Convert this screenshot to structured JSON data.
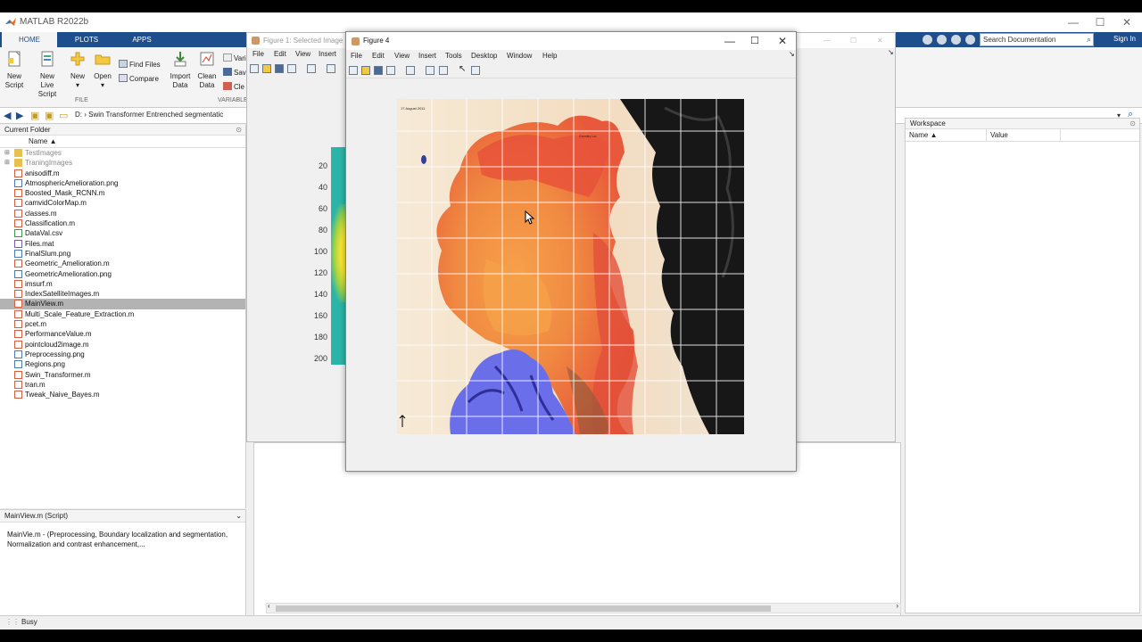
{
  "app": {
    "title": "MATLAB R2022b",
    "status": "Busy"
  },
  "ribbon_tabs": [
    "HOME",
    "PLOTS",
    "APPS"
  ],
  "search": {
    "placeholder": "Search Documentation"
  },
  "signin": "Sign In",
  "ribbon": {
    "new_script": [
      "New",
      "Script"
    ],
    "new_live_script": [
      "New",
      "Live Script"
    ],
    "new": "New",
    "open": "Open",
    "find_files": "Find Files",
    "compare": "Compare",
    "import_data": [
      "Import",
      "Data"
    ],
    "clean_data": [
      "Clean",
      "Data"
    ],
    "var": "Vari",
    "save": "Sav",
    "clear": "Cle",
    "group_file": "FILE",
    "group_variable": "VARIABLE"
  },
  "address": {
    "path": "D:  ›  Swin Transformer Entrenched segmentatic"
  },
  "current_folder": {
    "title": "Current Folder",
    "col_name": "Name ▲",
    "files": [
      {
        "name": "TestImages",
        "type": "folder"
      },
      {
        "name": "TraningImages",
        "type": "folder"
      },
      {
        "name": "anisodiff.m",
        "type": "m"
      },
      {
        "name": "AtmosphericAmelioration.png",
        "type": "png"
      },
      {
        "name": "Boosted_Mask_RCNN.m",
        "type": "m"
      },
      {
        "name": "camvidColorMap.m",
        "type": "m"
      },
      {
        "name": "classes.m",
        "type": "m"
      },
      {
        "name": "Classification.m",
        "type": "m"
      },
      {
        "name": "DataVal.csv",
        "type": "csv"
      },
      {
        "name": "Files.mat",
        "type": "mat"
      },
      {
        "name": "FinalSlum.png",
        "type": "png"
      },
      {
        "name": "Geometric_Amelioration.m",
        "type": "m"
      },
      {
        "name": "GeometricAmelioration.png",
        "type": "png"
      },
      {
        "name": "imsurf.m",
        "type": "m"
      },
      {
        "name": "IndexSatelliteImages.m",
        "type": "m"
      },
      {
        "name": "MainView.m",
        "type": "m"
      },
      {
        "name": "Multi_Scale_Feature_Extraction.m",
        "type": "m"
      },
      {
        "name": "pcet.m",
        "type": "m"
      },
      {
        "name": "PerformanceValue.m",
        "type": "m"
      },
      {
        "name": "pointcloud2image.m",
        "type": "m"
      },
      {
        "name": "Preprocessing.png",
        "type": "png"
      },
      {
        "name": "Regions.png",
        "type": "png"
      },
      {
        "name": "Swin_Transformer.m",
        "type": "m"
      },
      {
        "name": "tran.m",
        "type": "m"
      },
      {
        "name": "Tweak_Naive_Bayes.m",
        "type": "m"
      }
    ],
    "selected": "MainView.m"
  },
  "details": {
    "title": "MainView.m  (Script)",
    "text": "MainVie.m - (Preprocessing, Boundary localization and segmentation, Normalization and contrast enhancement,..."
  },
  "workspace": {
    "title": "Workspace",
    "col_name": "Name ▲",
    "col_value": "Value"
  },
  "figure1": {
    "title": "Figure 1: Selected Image",
    "menu": [
      "File",
      "Edit",
      "View",
      "Insert"
    ],
    "y_ticks": [
      "20",
      "40",
      "60",
      "80",
      "100",
      "120",
      "140",
      "160",
      "180",
      "200"
    ]
  },
  "figure4": {
    "title": "Figure 4",
    "menu": [
      "File",
      "Edit",
      "View",
      "Insert",
      "Tools",
      "Desktop",
      "Window",
      "Help"
    ],
    "image_caption": "17 August 2011",
    "image_label": "Gormley Loc"
  }
}
